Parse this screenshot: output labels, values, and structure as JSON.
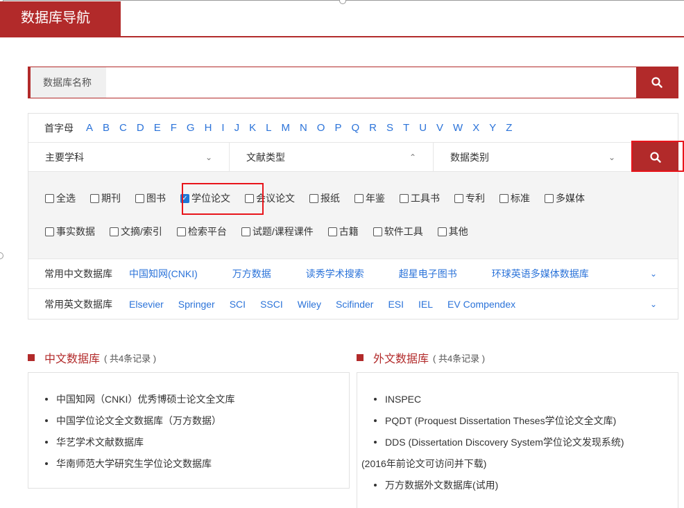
{
  "header": {
    "title": "数据库导航"
  },
  "search": {
    "label": "数据库名称",
    "placeholder": "",
    "value": ""
  },
  "letters": {
    "label": "首字母",
    "items": [
      "A",
      "B",
      "C",
      "D",
      "E",
      "F",
      "G",
      "H",
      "I",
      "J",
      "K",
      "L",
      "M",
      "N",
      "O",
      "P",
      "Q",
      "R",
      "S",
      "T",
      "U",
      "V",
      "W",
      "X",
      "Y",
      "Z"
    ]
  },
  "dropdowns": {
    "subject": "主要学科",
    "doc_type": "文献类型",
    "db_category": "数据类别"
  },
  "types": {
    "row1": [
      {
        "label": "全选",
        "checked": false
      },
      {
        "label": "期刊",
        "checked": false
      },
      {
        "label": "图书",
        "checked": false
      },
      {
        "label": "学位论文",
        "checked": true
      },
      {
        "label": "会议论文",
        "checked": false
      },
      {
        "label": "报纸",
        "checked": false
      },
      {
        "label": "年鉴",
        "checked": false
      },
      {
        "label": "工具书",
        "checked": false
      },
      {
        "label": "专利",
        "checked": false
      },
      {
        "label": "标准",
        "checked": false
      },
      {
        "label": "多媒体",
        "checked": false
      }
    ],
    "row2": [
      {
        "label": "事实数据",
        "checked": false
      },
      {
        "label": "文摘/索引",
        "checked": false
      },
      {
        "label": "检索平台",
        "checked": false
      },
      {
        "label": "试题/课程课件",
        "checked": false
      },
      {
        "label": "古籍",
        "checked": false
      },
      {
        "label": "软件工具",
        "checked": false
      },
      {
        "label": "其他",
        "checked": false
      }
    ]
  },
  "common_cn": {
    "label": "常用中文数据库",
    "items": [
      "中国知网(CNKI)",
      "万方数据",
      "读秀学术搜索",
      "超星电子图书",
      "环球英语多媒体数据库"
    ]
  },
  "common_en": {
    "label": "常用英文数据库",
    "items": [
      "Elsevier",
      "Springer",
      "SCI",
      "SSCI",
      "Wiley",
      "Scifinder",
      "ESI",
      "IEL",
      "EV Compendex"
    ]
  },
  "cn_db": {
    "title": "中文数据库",
    "count": "( 共4条记录 )",
    "items": [
      "中国知网（CNKI）优秀博硕士论文全文库",
      "中国学位论文全文数据库（万方数据）",
      "华艺学术文献数据库",
      "华南师范大学研究生学位论文数据库"
    ]
  },
  "en_db": {
    "title": "外文数据库",
    "count": "( 共4条记录 )",
    "item1": "INSPEC",
    "item2": "PQDT (Proquest Dissertation Theses学位论文全文库)",
    "item3": "DDS (Dissertation Discovery System学位论文发现系统)",
    "item3_note": "(2016年前论文可访问并下载)",
    "item4": "万方数据外文数据库(试用)"
  },
  "colors": {
    "brand": "#b22a2a",
    "link": "#2b73d9",
    "highlight": "#e8141a"
  }
}
